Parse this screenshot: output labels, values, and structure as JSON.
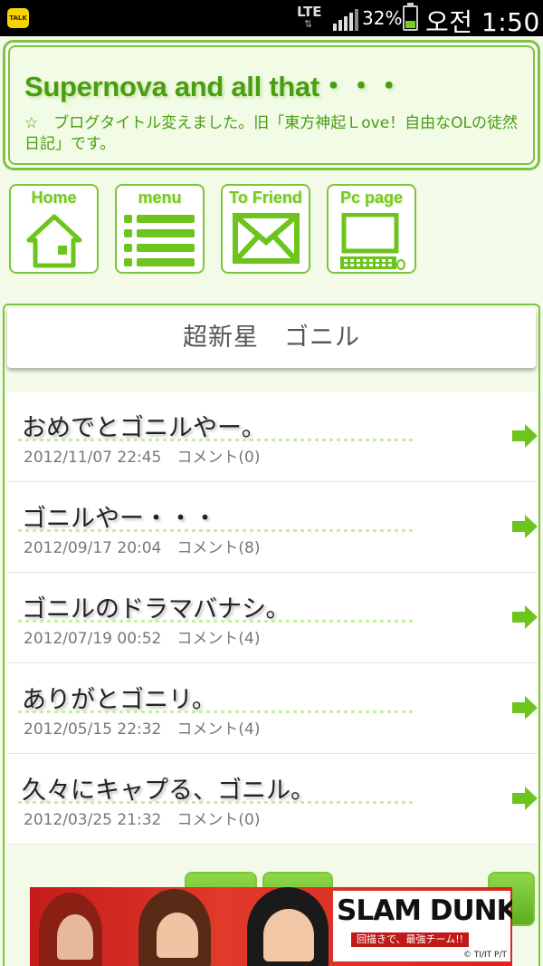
{
  "status_bar": {
    "app_icon": "kakaotalk-icon",
    "app_icon_text": "TALK",
    "network": "LTE",
    "battery_percent": "32%",
    "battery_level": 0.32,
    "time": "오전 1:50"
  },
  "header": {
    "title": "Supernova and all that・・・",
    "subtitle": "☆　ブログタイトル変えました。旧「東方神起Ｌove！自由なOLの徒然日記」です。",
    "accent_color": "#4a9d12"
  },
  "nav": [
    {
      "label": "Home",
      "icon": "house-icon"
    },
    {
      "label": "menu",
      "icon": "list-icon"
    },
    {
      "label": "To Friend",
      "icon": "envelope-icon"
    },
    {
      "label": "Pc page",
      "icon": "computer-icon"
    }
  ],
  "category": {
    "title": "超新星　ゴニル"
  },
  "entries": [
    {
      "title": "おめでとゴニルやー。",
      "date": "2012/11/07 22:45",
      "comments": "コメント(0)"
    },
    {
      "title": "ゴニルやー・・・",
      "date": "2012/09/17 20:04",
      "comments": "コメント(8)"
    },
    {
      "title": "ゴニルのドラマバナシ。",
      "date": "2012/07/19 00:52",
      "comments": "コメント(4)"
    },
    {
      "title": "ありがとゴニリ。",
      "date": "2012/05/15 22:32",
      "comments": "コメント(4)"
    },
    {
      "title": "久々にキャプる、ゴニル。",
      "date": "2012/03/25 21:32",
      "comments": "コメント(0)"
    }
  ],
  "banner": {
    "logo": "SLAM DUNK",
    "tagline": "回描きで、最強チーム!!",
    "copyright": "© TI/IT P/T"
  },
  "colors": {
    "border_green": "#7bc53a",
    "arrow_green": "#6cc41c",
    "background": "#f3fbe8"
  }
}
